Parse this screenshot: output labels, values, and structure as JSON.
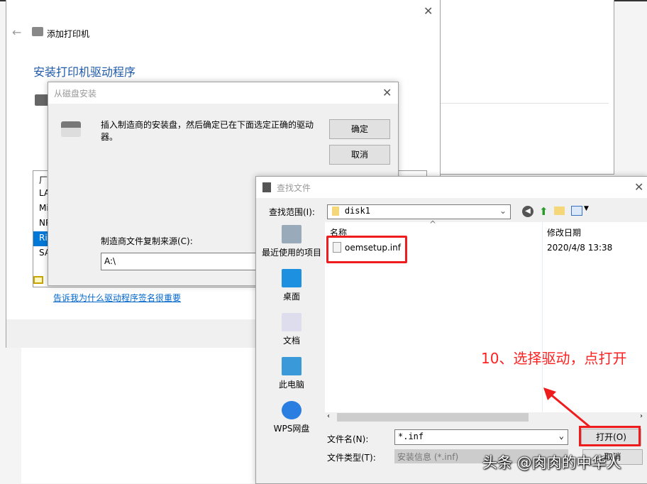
{
  "add_printer": {
    "title": "添加打印机",
    "heading": "安装打印机驱动程序",
    "list_header": "厂",
    "list_items": [
      "LA",
      "Mi",
      "NP",
      "Ri",
      "SA"
    ],
    "selected_index": 3,
    "link": "告诉我为什么驱动程序签名很重要"
  },
  "disk_dialog": {
    "title": "从磁盘安装",
    "message": "插入制造商的安装盘，然后确定已在下面选定正确的驱动器。",
    "ok": "确定",
    "cancel": "取消",
    "source_label": "制造商文件复制来源(C):",
    "source_value": "A:\\"
  },
  "find_dialog": {
    "title": "查找文件",
    "look_in_label": "查找范围(I):",
    "look_in_value": "disk1",
    "places": [
      {
        "label": "最近使用的项目",
        "icon": "recent-icon"
      },
      {
        "label": "桌面",
        "icon": "desktop-icon"
      },
      {
        "label": "文档",
        "icon": "documents-icon"
      },
      {
        "label": "此电脑",
        "icon": "computer-icon"
      },
      {
        "label": "WPS网盘",
        "icon": "cloud-icon"
      }
    ],
    "columns": {
      "name": "名称",
      "modified": "修改日期"
    },
    "files": [
      {
        "name": "oemsetup.inf",
        "modified": "2020/4/8 13:38"
      }
    ],
    "filename_label": "文件名(N):",
    "filename_value": "*.inf",
    "filetype_label": "文件类型(T):",
    "filetype_value": "安装信息 (*.inf)",
    "open": "打开(O)",
    "cancel": "取消"
  },
  "annotation": {
    "text": "10、选择驱动，点打开",
    "color": "#ff2020"
  },
  "watermark": "头条 @肉肉的中华人"
}
